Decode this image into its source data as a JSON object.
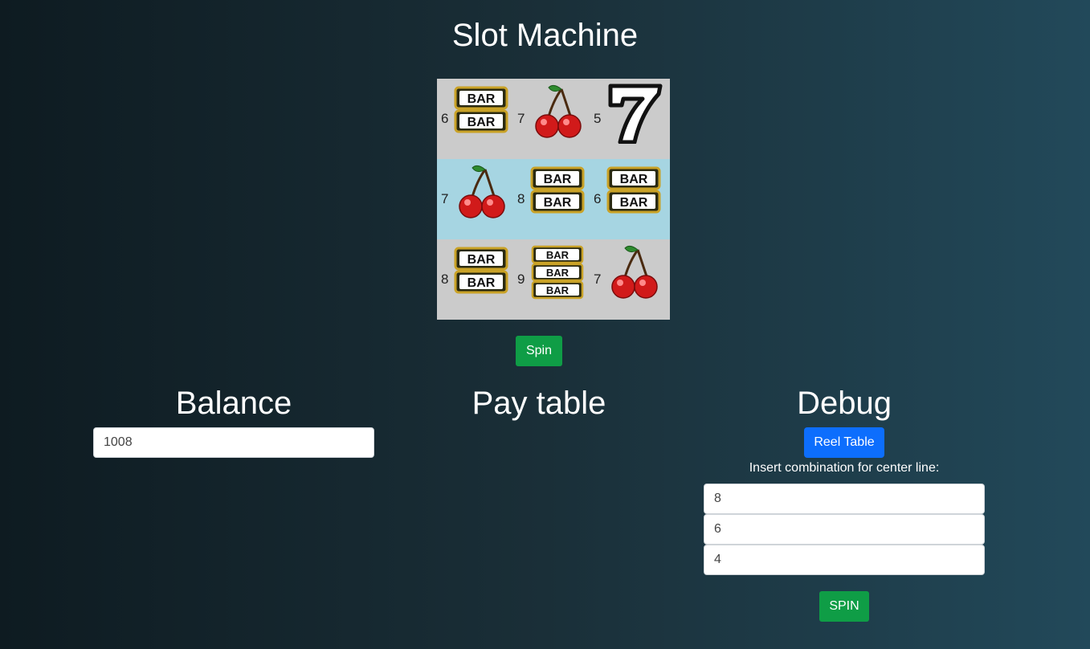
{
  "page": {
    "title": "Slot Machine"
  },
  "reels": {
    "rows": [
      [
        {
          "number": "6",
          "symbol": "double-bar"
        },
        {
          "number": "7",
          "symbol": "cherry"
        },
        {
          "number": "5",
          "symbol": "seven"
        }
      ],
      [
        {
          "number": "7",
          "symbol": "cherry"
        },
        {
          "number": "8",
          "symbol": "double-bar"
        },
        {
          "number": "6",
          "symbol": "double-bar"
        }
      ],
      [
        {
          "number": "8",
          "symbol": "double-bar"
        },
        {
          "number": "9",
          "symbol": "triple-bar"
        },
        {
          "number": "7",
          "symbol": "cherry"
        }
      ]
    ],
    "bar_text": "BAR"
  },
  "spin_button": {
    "label": "Spin"
  },
  "balance": {
    "heading": "Balance",
    "value": "1008"
  },
  "pay_table": {
    "heading": "Pay table"
  },
  "debug": {
    "heading": "Debug",
    "reel_table_label": "Reel Table",
    "insert_label": "Insert combination for center line:",
    "inputs": [
      "8",
      "6",
      "4"
    ],
    "spin_label": "SPIN"
  },
  "colors": {
    "spin_green": "#0f9d46",
    "reel_table_blue": "#0d6efd",
    "reel_gray": "#cbcbcb",
    "center_line": "#a6d5e2"
  }
}
